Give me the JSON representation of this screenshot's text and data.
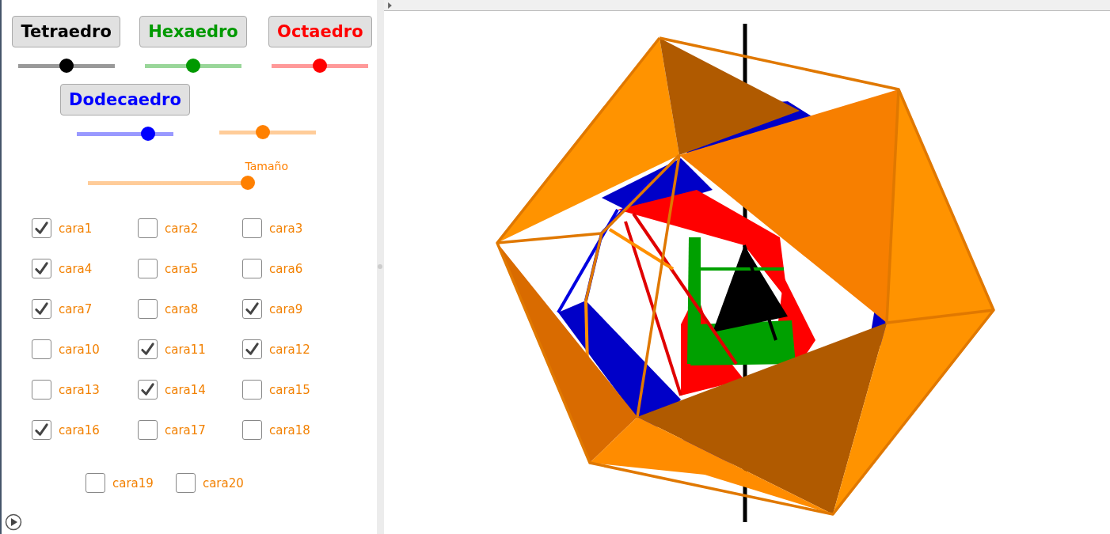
{
  "solids": [
    {
      "label": "Tetraedro",
      "color": "#000000",
      "level": 0.5
    },
    {
      "label": "Hexaedro",
      "color": "#009900",
      "level": 0.5
    },
    {
      "label": "Octaedro",
      "color": "#ff0000",
      "level": 0.5
    }
  ],
  "dodeca": {
    "label": "Dodecaedro",
    "color": "#0000ff",
    "level": 0.74
  },
  "extra_slider": {
    "color": "#ff8000",
    "level": 0.45
  },
  "size_slider": {
    "label": "Tamaño",
    "color": "#ff8000",
    "level": 1
  },
  "faces": [
    {
      "label": "cara1",
      "checked": true
    },
    {
      "label": "cara2",
      "checked": false
    },
    {
      "label": "cara3",
      "checked": false
    },
    {
      "label": "cara4",
      "checked": true
    },
    {
      "label": "cara5",
      "checked": false
    },
    {
      "label": "cara6",
      "checked": false
    },
    {
      "label": "cara7",
      "checked": true
    },
    {
      "label": "cara8",
      "checked": false
    },
    {
      "label": "cara9",
      "checked": true
    },
    {
      "label": "cara10",
      "checked": false
    },
    {
      "label": "cara11",
      "checked": true
    },
    {
      "label": "cara12",
      "checked": true
    },
    {
      "label": "cara13",
      "checked": false
    },
    {
      "label": "cara14",
      "checked": true
    },
    {
      "label": "cara15",
      "checked": false
    },
    {
      "label": "cara16",
      "checked": true
    },
    {
      "label": "cara17",
      "checked": false
    },
    {
      "label": "cara18",
      "checked": false
    },
    {
      "label": "cara19",
      "checked": false
    },
    {
      "label": "cara20",
      "checked": false
    }
  ]
}
